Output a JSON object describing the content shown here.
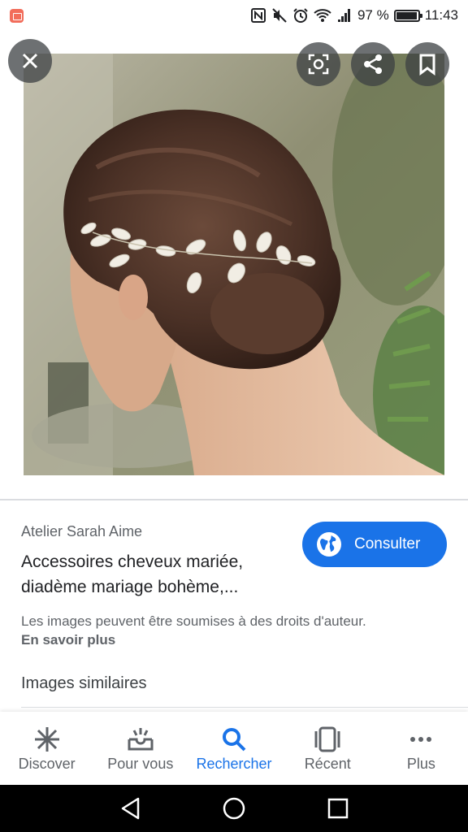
{
  "status_bar": {
    "battery_text": "97 %",
    "time": "11:43",
    "icons": [
      "nfc-icon",
      "mute-icon",
      "alarm-icon",
      "wifi-icon",
      "signal-icon",
      "battery-icon"
    ]
  },
  "viewer": {
    "buttons": [
      "close-icon",
      "lens-icon",
      "share-icon",
      "bookmark-icon"
    ]
  },
  "result": {
    "source": "Atelier Sarah Aime",
    "title_line1": "Accessoires cheveux mariée,",
    "title_line2": "diadème mariage bohème,...",
    "consult_label": "Consulter",
    "copyright_notice": "Les images peuvent être soumises à des droits d'auteur.",
    "learn_more": "En savoir plus",
    "similar_images": "Images similaires"
  },
  "bottom_nav": {
    "items": [
      {
        "label": "Discover",
        "icon": "asterisk-icon"
      },
      {
        "label": "Pour vous",
        "icon": "inbox-icon"
      },
      {
        "label": "Rechercher",
        "icon": "search-icon"
      },
      {
        "label": "Récent",
        "icon": "recent-tabs-icon"
      },
      {
        "label": "Plus",
        "icon": "more-icon"
      }
    ],
    "active_index": 2
  },
  "colors": {
    "accent": "#1a73e8",
    "text_primary": "#202124",
    "text_secondary": "#5f6368"
  }
}
